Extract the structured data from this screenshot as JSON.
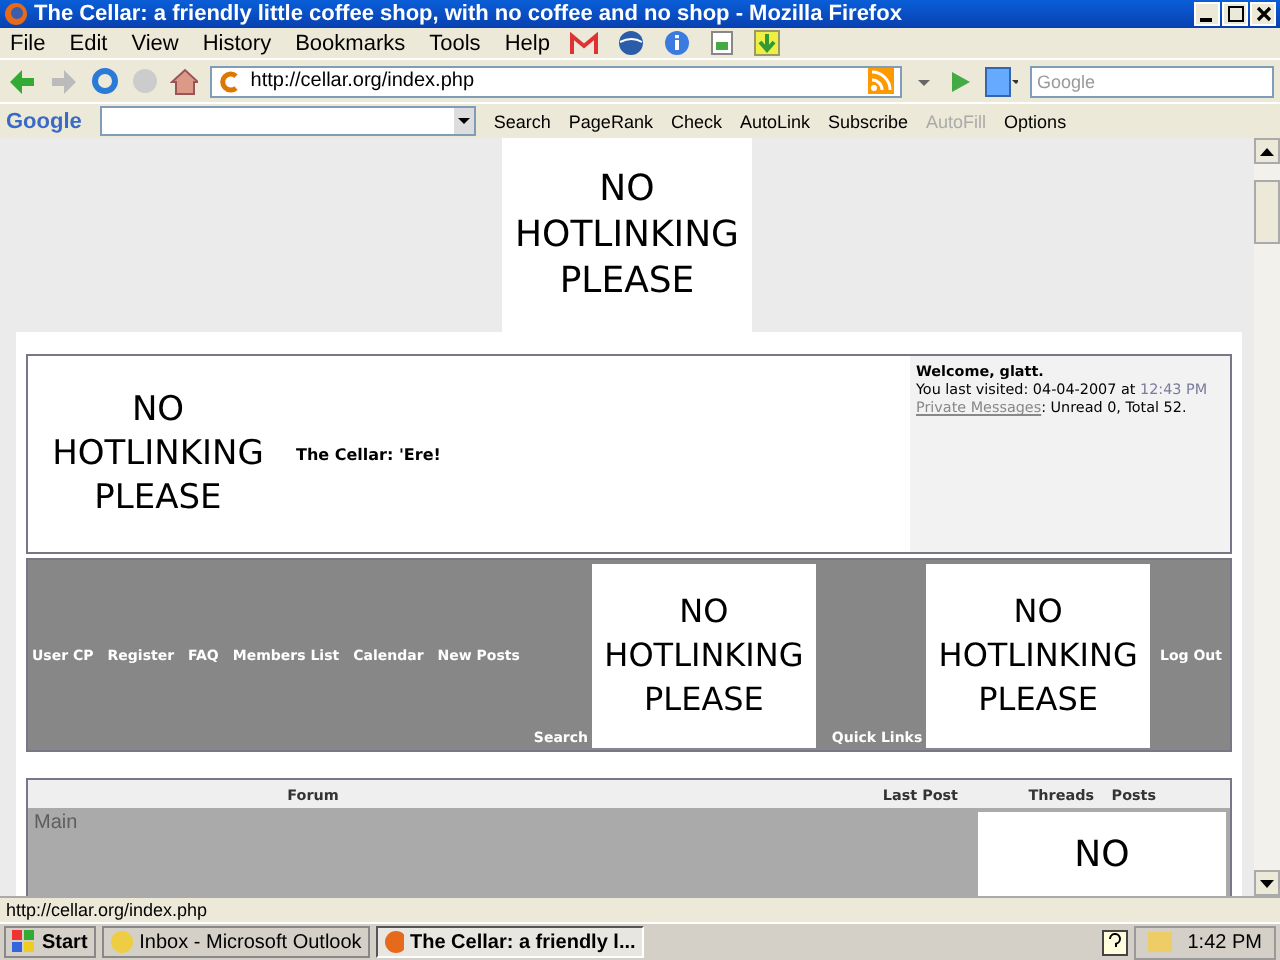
{
  "window": {
    "title": "The Cellar: a friendly little coffee shop, with no coffee and no shop - Mozilla Firefox"
  },
  "menu": [
    "File",
    "Edit",
    "View",
    "History",
    "Bookmarks",
    "Tools",
    "Help"
  ],
  "address": {
    "value": "http://cellar.org/index.php"
  },
  "search": {
    "placeholder": "Google"
  },
  "google_toolbar": {
    "logo": "Google",
    "items": [
      {
        "label": "Search",
        "disabled": false
      },
      {
        "label": "PageRank",
        "disabled": false
      },
      {
        "label": "Check",
        "disabled": false
      },
      {
        "label": "AutoLink",
        "disabled": false
      },
      {
        "label": "Subscribe",
        "disabled": false
      },
      {
        "label": "AutoFill",
        "disabled": true
      },
      {
        "label": "Options",
        "disabled": false
      }
    ]
  },
  "banner": {
    "text": "NO\nHOTLINKING\nPLEASE"
  },
  "header": {
    "logo": "NO\nHOTLINKING\nPLEASE",
    "tagline": "The Cellar: 'Ere!",
    "welcome": "Welcome, glatt.",
    "last_visited": "You last visited: 04-04-2007 at",
    "last_time": "12:43 PM",
    "pm_link": "Private Messages",
    "pm_counts": ": Unread 0, Total 52."
  },
  "navbar": {
    "links": [
      "User CP",
      "Register",
      "FAQ",
      "Members List",
      "Calendar",
      "New Posts"
    ],
    "search": "Search",
    "search_image": "NO\nHOTLINKING\nPLEASE",
    "quick_links": "Quick Links",
    "quick_image": "NO\nHOTLINKING\nPLEASE",
    "logout": "Log Out"
  },
  "forum_table": {
    "columns": [
      "Forum",
      "Last Post",
      "Threads",
      "Posts"
    ],
    "category": "Main",
    "image": "NO"
  },
  "status_bar": "http://cellar.org/index.php",
  "taskbar": {
    "start": "Start",
    "tasks": [
      {
        "label": "Inbox - Microsoft Outlook",
        "selected": false
      },
      {
        "label": "The Cellar: a friendly l...",
        "selected": true
      }
    ],
    "clock": "1:42 PM"
  }
}
